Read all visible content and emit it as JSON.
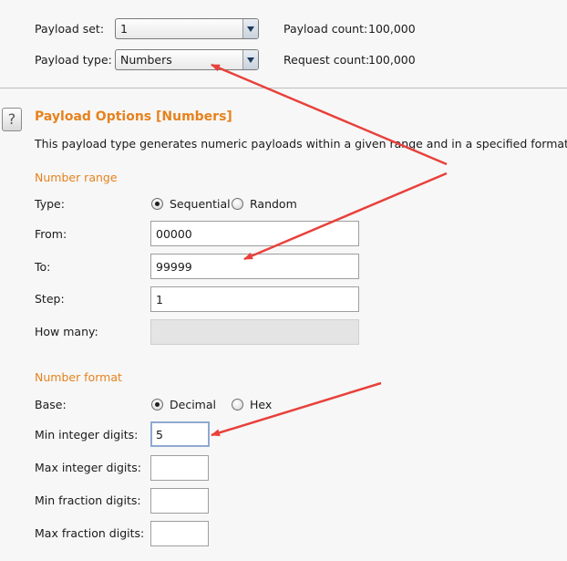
{
  "header": {
    "payload_set_label": "Payload set:",
    "payload_set_value": "1",
    "payload_type_label": "Payload type:",
    "payload_type_value": "Numbers",
    "payload_count_label": "Payload count:",
    "payload_count_value": "100,000",
    "request_count_label": "Request count:",
    "request_count_value": "100,000"
  },
  "options": {
    "help_glyph": "?",
    "title": "Payload Options [Numbers]",
    "description": "This payload type generates numeric payloads within a given range and in a specified format."
  },
  "number_range": {
    "heading": "Number range",
    "type_label": "Type:",
    "sequential_label": "Sequential",
    "random_label": "Random",
    "selected_type": "Sequential",
    "from_label": "From:",
    "from_value": "00000",
    "to_label": "To:",
    "to_value": "99999",
    "step_label": "Step:",
    "step_value": "1",
    "how_many_label": "How many:",
    "how_many_value": ""
  },
  "number_format": {
    "heading": "Number format",
    "base_label": "Base:",
    "decimal_label": "Decimal",
    "hex_label": "Hex",
    "selected_base": "Decimal",
    "min_int_label": "Min integer digits:",
    "min_int_value": "5",
    "max_int_label": "Max integer digits:",
    "max_int_value": "",
    "min_frac_label": "Min fraction digits:",
    "min_frac_value": "",
    "max_frac_label": "Max fraction digits:",
    "max_frac_value": ""
  },
  "colors": {
    "accent": "#e6821e",
    "annotation_arrow": "#e8413b",
    "focus_border": "#8fa9d0"
  }
}
